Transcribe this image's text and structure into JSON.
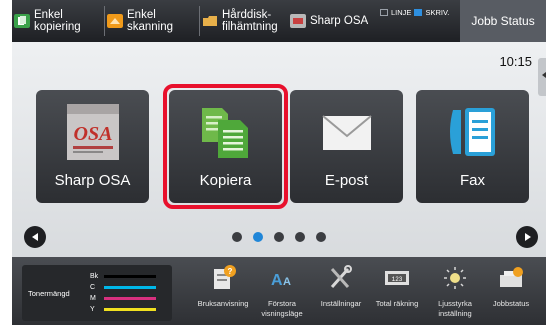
{
  "topbar": {
    "items": [
      {
        "label": "Enkel\nkopiering",
        "icon": "copy-icon"
      },
      {
        "label": "Enkel\nskanning",
        "icon": "scan-icon"
      },
      {
        "label": "Hårddisk-\nfilhämtning",
        "icon": "folder-icon"
      },
      {
        "label": "Sharp OSA",
        "icon": "osa-icon"
      }
    ],
    "indicator_line": "LINJE",
    "indicator_print": "SKRIV.",
    "job_status": "Jobb Status"
  },
  "clock": "10:15",
  "tiles": [
    {
      "label": "Sharp OSA",
      "icon": "osa-logo-icon"
    },
    {
      "label": "Kopiera",
      "icon": "copy-documents-icon"
    },
    {
      "label": "E-post",
      "icon": "envelope-icon"
    },
    {
      "label": "Fax",
      "icon": "fax-phone-icon"
    }
  ],
  "page_indicator": {
    "total": 5,
    "current": 2
  },
  "toner": {
    "label": "Tonermängd",
    "levels": [
      {
        "name": "Bk",
        "color": "#000000",
        "level": 1.0
      },
      {
        "name": "C",
        "color": "#00b7e8",
        "level": 1.0
      },
      {
        "name": "M",
        "color": "#d8307f",
        "level": 1.0
      },
      {
        "name": "Y",
        "color": "#f0e020",
        "level": 1.0
      }
    ]
  },
  "bottom_items": [
    {
      "label": "Bruksanvisning",
      "icon": "manual-icon"
    },
    {
      "label": "Förstora\nvisningsläge",
      "icon": "enlarge-text-icon"
    },
    {
      "label": "Inställningar",
      "icon": "tools-icon"
    },
    {
      "label": "Total räkning",
      "icon": "counter-icon"
    },
    {
      "label": "Ljusstyrka\ninställning",
      "icon": "brightness-icon"
    },
    {
      "label": "Jobbstatus",
      "icon": "job-status-icon"
    }
  ],
  "colors": {
    "highlight": "#e8102c",
    "active_dot": "#1f86d8",
    "accent_blue": "#2e8fe0"
  }
}
